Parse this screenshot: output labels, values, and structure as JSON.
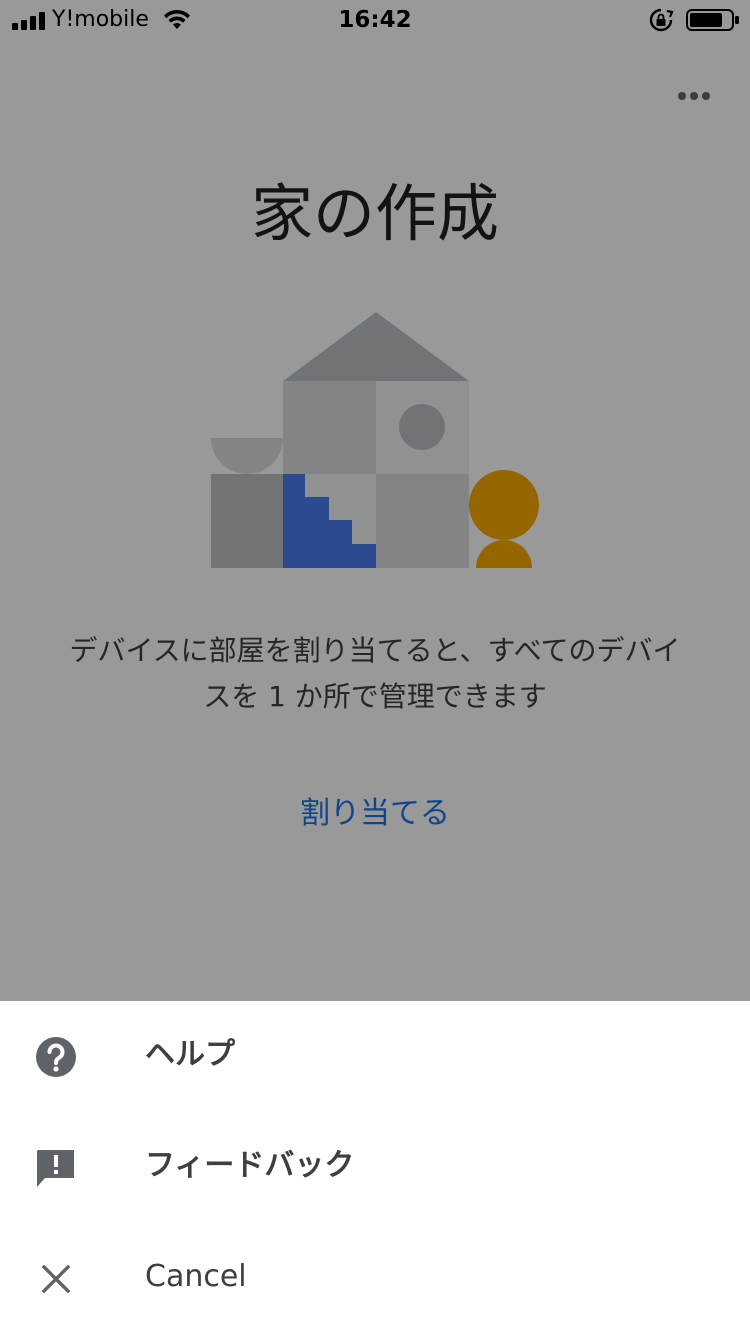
{
  "status_bar": {
    "carrier": "Y!mobile",
    "time": "16:42",
    "icons": [
      "signal-icon",
      "wifi-icon",
      "rotation-lock-icon",
      "battery-icon"
    ]
  },
  "header": {
    "menu_icon": "more-horizontal-icon"
  },
  "main": {
    "title": "家の作成",
    "description_line1": "デバイスに部屋を割り当てると、すべてのデバイ",
    "description_line2": "スを 1 か所で管理できます",
    "assign_link": "割り当てる"
  },
  "action_sheet": {
    "items": [
      {
        "label": "ヘルプ",
        "icon": "help-circle-icon"
      },
      {
        "label": "フィードバック",
        "icon": "feedback-icon"
      },
      {
        "label": "Cancel",
        "icon": "close-icon"
      }
    ]
  },
  "colors": {
    "accent_blue": "#1a73e8",
    "illustration_blue": "#4a7cf0",
    "illustration_yellow": "#f9ab00",
    "scrim": "rgba(0,0,0,0.40)",
    "sheet_icon_gray": "#5f6368"
  }
}
